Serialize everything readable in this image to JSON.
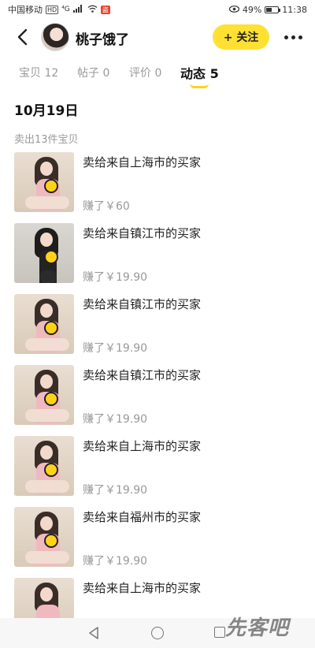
{
  "status_bar": {
    "carrier": "中国移动",
    "network_badge": "HD",
    "signal_label": "⁴G",
    "app_badge": "盗",
    "battery_percent": "49%",
    "battery_level": 0.49,
    "time": "11:38"
  },
  "header": {
    "user_name": "桃子饿了",
    "follow_label": "+ 关注"
  },
  "tabs": [
    {
      "label": "宝贝 12"
    },
    {
      "label": "帖子 0"
    },
    {
      "label": "评价 0"
    },
    {
      "label": "动态 5",
      "active": true
    }
  ],
  "feed": {
    "date": "10月19日",
    "summary": "卖出13件宝贝",
    "items": [
      {
        "title": "卖给来自上海市的买家",
        "earned": "赚了￥60"
      },
      {
        "title": "卖给来自镇江市的买家",
        "earned": "赚了￥19.90"
      },
      {
        "title": "卖给来自镇江市的买家",
        "earned": "赚了￥19.90"
      },
      {
        "title": "卖给来自镇江市的买家",
        "earned": "赚了￥19.90"
      },
      {
        "title": "卖给来自上海市的买家",
        "earned": "赚了￥19.90"
      },
      {
        "title": "卖给来自福州市的买家",
        "earned": "赚了￥19.90"
      },
      {
        "title": "卖给来自上海市的买家",
        "earned": ""
      }
    ]
  },
  "watermark": "先客吧",
  "colors": {
    "accent_yellow": "#ffe033",
    "indicator_yellow": "#ffd21a",
    "muted_text": "#999999"
  }
}
